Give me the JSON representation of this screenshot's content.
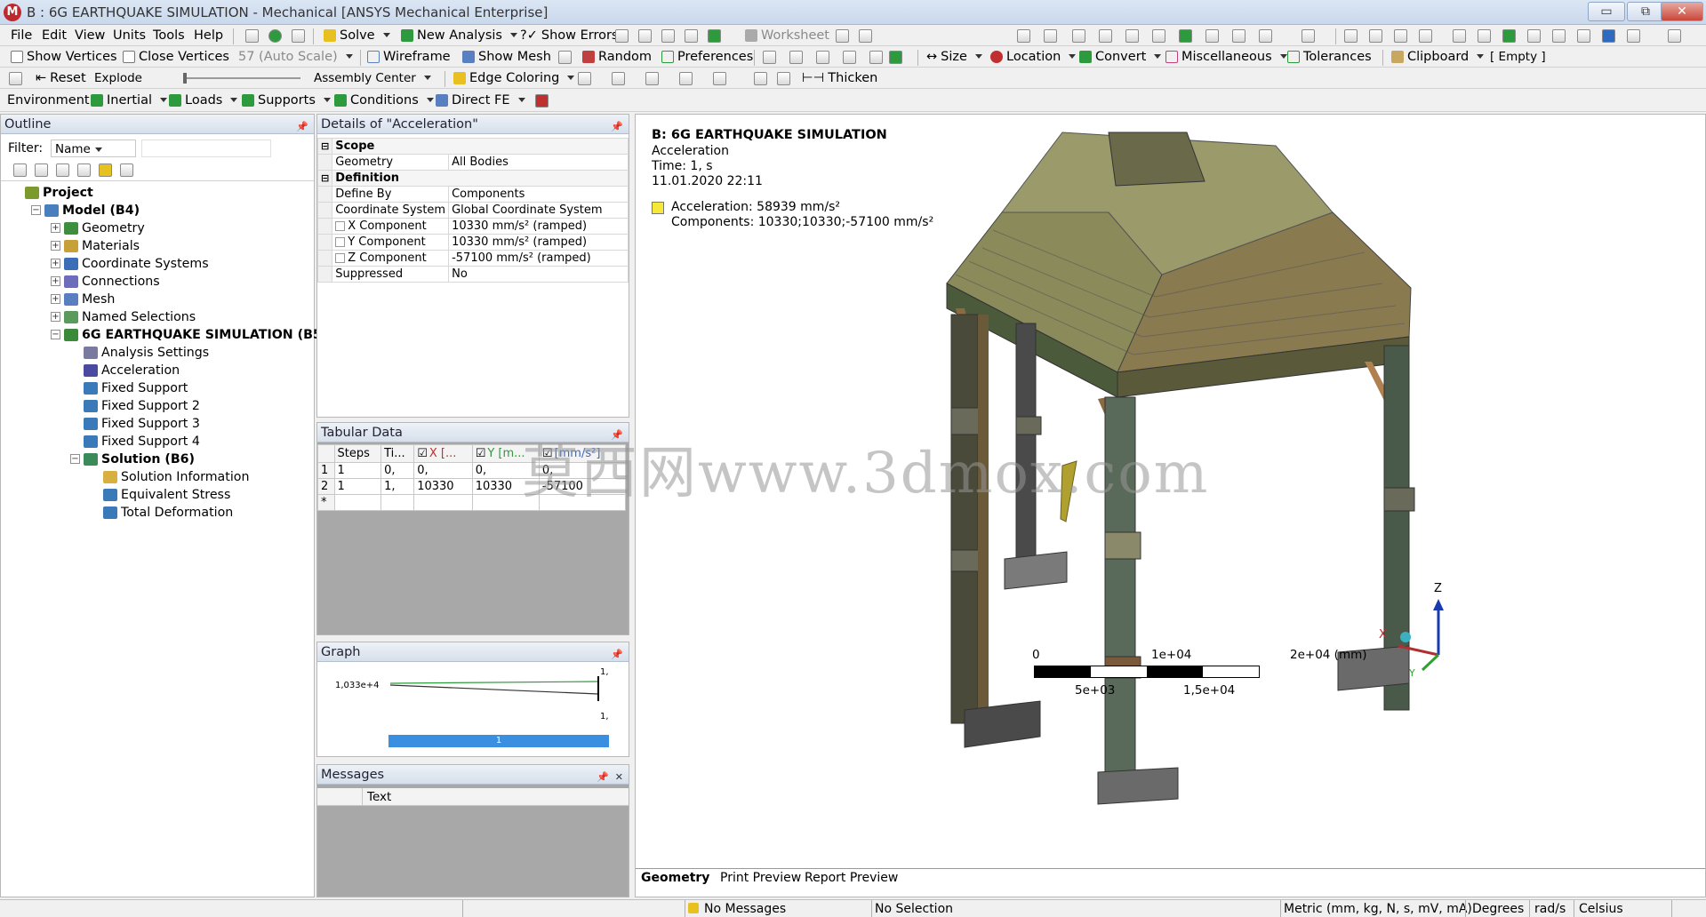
{
  "title": "B : 6G EARTHQUAKE SIMULATION - Mechanical [ANSYS Mechanical Enterprise]",
  "window_controls": {
    "minimize": "▭",
    "maximize": "⧉",
    "close": "✕"
  },
  "menu": [
    "File",
    "Edit",
    "View",
    "Units",
    "Tools",
    "Help"
  ],
  "toolbar1": {
    "solve": "Solve",
    "new_analysis": "New Analysis",
    "show_errors": "Show Errors",
    "worksheet": "Worksheet"
  },
  "toolbar2": {
    "show_vertices": "Show Vertices",
    "close_vertices": "Close Vertices",
    "scale": "57 (Auto Scale)",
    "wireframe": "Wireframe",
    "show_mesh": "Show Mesh",
    "random": "Random",
    "preferences": "Preferences",
    "size": "Size",
    "location": "Location",
    "convert": "Convert",
    "miscellaneous": "Miscellaneous",
    "tolerances": "Tolerances",
    "clipboard": "Clipboard",
    "empty": "[ Empty ]"
  },
  "toolbar3": {
    "reset": "Reset",
    "explode": "Explode",
    "assembly_center": "Assembly Center",
    "edge_coloring": "Edge Coloring",
    "thicken": "Thicken"
  },
  "toolbar4": {
    "environment": "Environment",
    "inertial": "Inertial",
    "loads": "Loads",
    "supports": "Supports",
    "conditions": "Conditions",
    "direct_fe": "Direct FE"
  },
  "outline": {
    "title": "Outline",
    "filter_label": "Filter:",
    "filter_value": "Name",
    "items": [
      {
        "label": "Project",
        "level": 0,
        "bold": true,
        "color": "#7a9a2e",
        "exp": ""
      },
      {
        "label": "Model (B4)",
        "level": 1,
        "bold": true,
        "color": "#4a7fbf",
        "exp": "−"
      },
      {
        "label": "Geometry",
        "level": 2,
        "bold": false,
        "color": "#3d8f3d",
        "exp": "+"
      },
      {
        "label": "Materials",
        "level": 2,
        "bold": false,
        "color": "#c8a038",
        "exp": "+"
      },
      {
        "label": "Coordinate Systems",
        "level": 2,
        "bold": false,
        "color": "#3a6fb8",
        "exp": "+"
      },
      {
        "label": "Connections",
        "level": 2,
        "bold": false,
        "color": "#6d6dbb",
        "exp": "+"
      },
      {
        "label": "Mesh",
        "level": 2,
        "bold": false,
        "color": "#5a7fc0",
        "exp": "+"
      },
      {
        "label": "Named Selections",
        "level": 2,
        "bold": false,
        "color": "#5a9a5a",
        "exp": "+"
      },
      {
        "label": "6G EARTHQUAKE SIMULATION (B5)",
        "level": 2,
        "bold": true,
        "color": "#3a8a3a",
        "exp": "−"
      },
      {
        "label": "Analysis Settings",
        "level": 3,
        "bold": false,
        "color": "#7a7aa0",
        "exp": ""
      },
      {
        "label": "Acceleration",
        "level": 3,
        "bold": false,
        "color": "#4a4aa0",
        "exp": ""
      },
      {
        "label": "Fixed Support",
        "level": 3,
        "bold": false,
        "color": "#3a7ab8",
        "exp": ""
      },
      {
        "label": "Fixed Support 2",
        "level": 3,
        "bold": false,
        "color": "#3a7ab8",
        "exp": ""
      },
      {
        "label": "Fixed Support 3",
        "level": 3,
        "bold": false,
        "color": "#3a7ab8",
        "exp": ""
      },
      {
        "label": "Fixed Support 4",
        "level": 3,
        "bold": false,
        "color": "#3a7ab8",
        "exp": ""
      },
      {
        "label": "Solution (B6)",
        "level": 3,
        "bold": true,
        "color": "#3a8a5a",
        "exp": "−"
      },
      {
        "label": "Solution Information",
        "level": 4,
        "bold": false,
        "color": "#d8b040",
        "exp": ""
      },
      {
        "label": "Equivalent Stress",
        "level": 4,
        "bold": false,
        "color": "#3a7ab8",
        "exp": ""
      },
      {
        "label": "Total Deformation",
        "level": 4,
        "bold": false,
        "color": "#3a7ab8",
        "exp": ""
      }
    ]
  },
  "details": {
    "title": "Details of \"Acceleration\"",
    "rows": [
      {
        "label": "Scope",
        "value": "",
        "group": true,
        "check": false
      },
      {
        "label": "Geometry",
        "value": "All Bodies",
        "group": false,
        "check": false
      },
      {
        "label": "Definition",
        "value": "",
        "group": true,
        "check": false
      },
      {
        "label": "Define By",
        "value": "Components",
        "group": false,
        "check": false
      },
      {
        "label": "Coordinate System",
        "value": "Global Coordinate System",
        "group": false,
        "check": false
      },
      {
        "label": "X Component",
        "value": "10330 mm/s²  (ramped)",
        "group": false,
        "check": true
      },
      {
        "label": "Y Component",
        "value": "10330 mm/s²  (ramped)",
        "group": false,
        "check": true
      },
      {
        "label": "Z Component",
        "value": "-57100 mm/s²  (ramped)",
        "group": false,
        "check": true
      },
      {
        "label": "Suppressed",
        "value": "No",
        "group": false,
        "check": false
      }
    ]
  },
  "tabular": {
    "title": "Tabular Data",
    "headers": [
      "",
      "Steps",
      "Ti...",
      "X [...",
      "Y [m...",
      "[mm/s²]"
    ],
    "rows": [
      [
        "1",
        "1",
        "0,",
        "0,",
        "0,",
        "0,"
      ],
      [
        "2",
        "1",
        "1,",
        "10330",
        "10330",
        "-57100"
      ],
      [
        "*",
        "",
        "",
        "",
        "",
        ""
      ]
    ]
  },
  "graph": {
    "title": "Graph",
    "y_value": "1,033e+4",
    "right_top": "1,",
    "right_bottom": "1,",
    "bar_label": "1"
  },
  "messages": {
    "title": "Messages",
    "col": "Text"
  },
  "viewport": {
    "title": "B: 6G EARTHQUAKE SIMULATION",
    "subtitle": "Acceleration",
    "time": "Time: 1, s",
    "date": "11.01.2020 22:11",
    "legend_line1": "Acceleration: 58939 mm/s²",
    "legend_line2": "Components: 10330;10330;-57100 mm/s²",
    "legend_color": "#f5e83a",
    "watermark": "莫西网www.3dmox.com",
    "scale": {
      "t0": "0",
      "t1": "1e+04",
      "t2": "2e+04 (mm)",
      "b1": "5e+03",
      "b2": "1,5e+04"
    },
    "axes": {
      "z": "Z",
      "x": "X",
      "y": "Y"
    },
    "tabs": [
      "Geometry",
      "Print Preview",
      "Report Preview"
    ]
  },
  "status": {
    "messages": "No Messages",
    "selection": "No Selection",
    "units": "Metric (mm, kg, N, s, mV, mA)",
    "angle": "Degrees",
    "rate": "rad/s",
    "temp": "Celsius"
  }
}
